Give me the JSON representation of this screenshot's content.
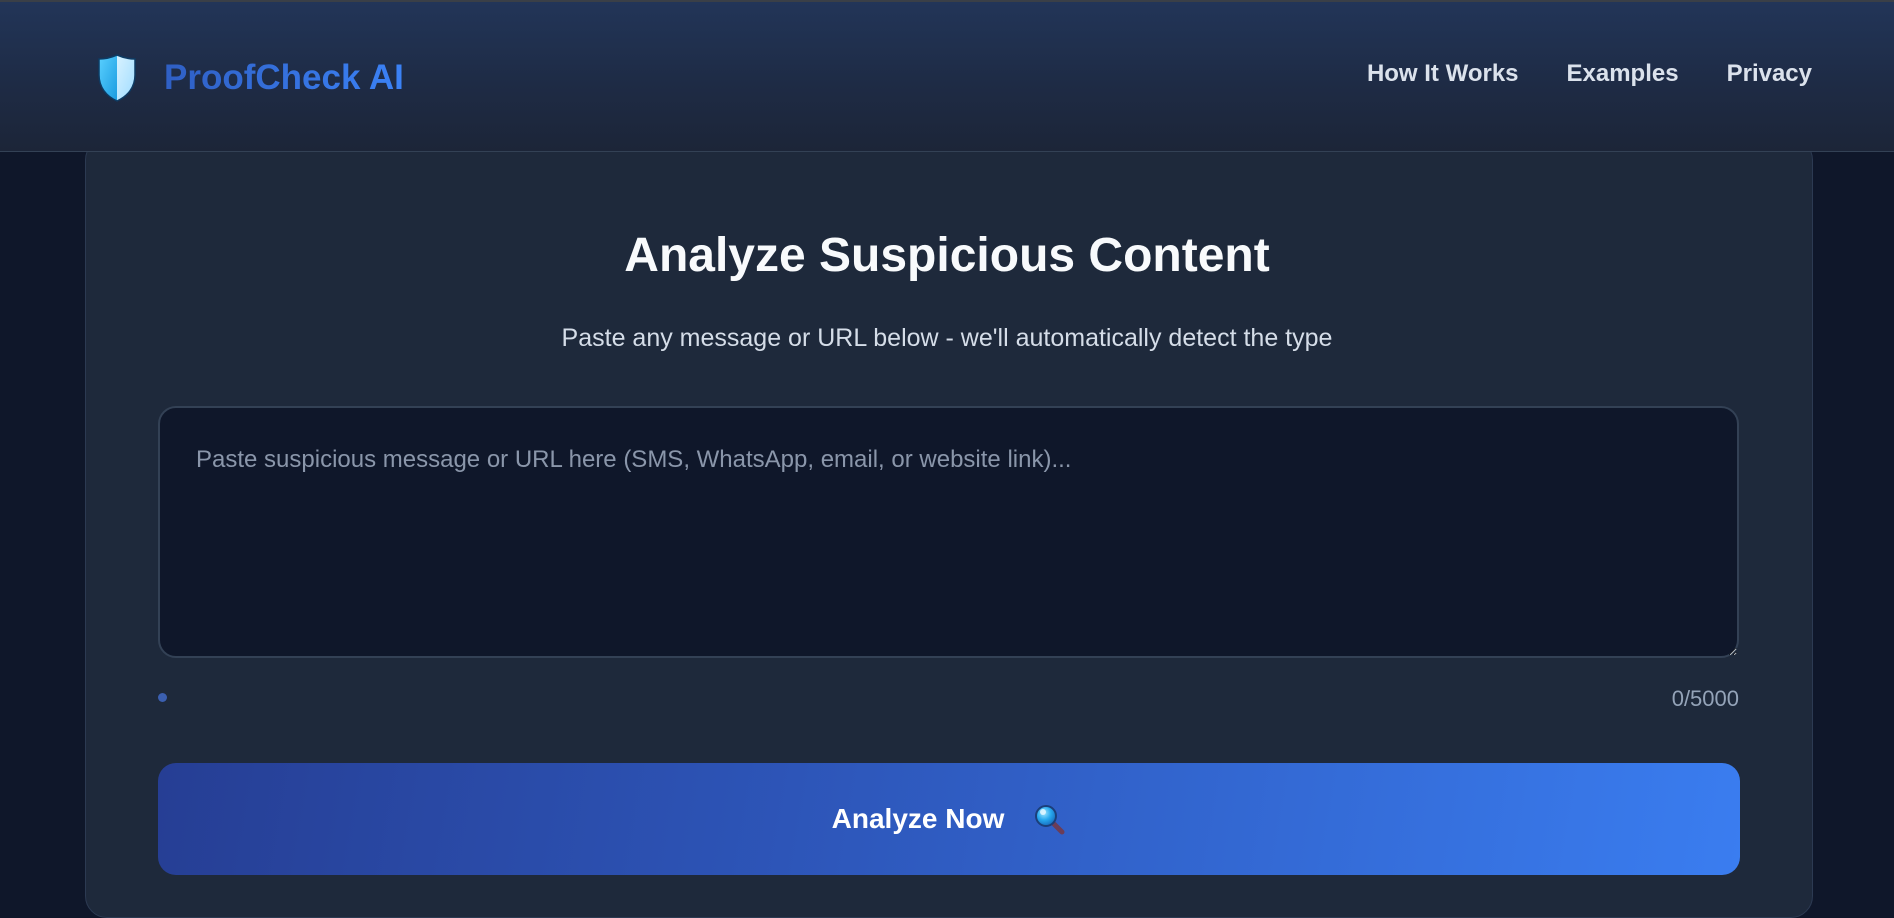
{
  "header": {
    "brand_name": "ProofCheck AI",
    "logo_icon": "shield-icon",
    "nav": [
      {
        "label": "How It Works"
      },
      {
        "label": "Examples"
      },
      {
        "label": "Privacy"
      }
    ]
  },
  "main": {
    "title": "Analyze Suspicious Content",
    "subtitle": "Paste any message or URL below - we'll automatically detect the type",
    "input": {
      "value": "",
      "placeholder": "Paste suspicious message or URL here (SMS, WhatsApp, email, or website link)..."
    },
    "char_count": "0/5000",
    "analyze_button": {
      "label": "Analyze Now",
      "icon": "magnifier-icon"
    }
  },
  "colors": {
    "brand": "#3b82f6",
    "background": "#0f172a",
    "card": "#1e293b",
    "button_start": "#263e94",
    "button_end": "#3a7df0"
  }
}
